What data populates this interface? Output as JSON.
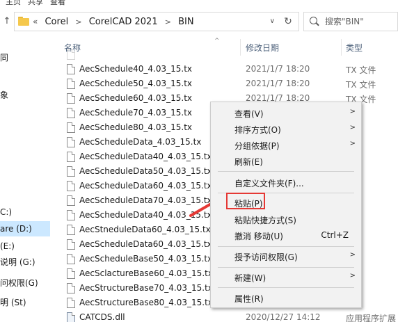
{
  "top_menu": [
    "主页",
    "共享",
    "查看"
  ],
  "address": {
    "prefix": "«",
    "crumbs": [
      "Corel",
      "CorelCAD 2021",
      "BIN"
    ],
    "search_placeholder": "搜索\"BIN\""
  },
  "nav": {
    "items": [
      {
        "label": "同",
        "selected": false
      },
      {
        "label": "象",
        "selected": false
      },
      {
        "label": "C:)",
        "selected": false
      },
      {
        "label": "are (D:)",
        "selected": true
      },
      {
        "label": "(E:)",
        "selected": false
      },
      {
        "label": "说明 (G:)",
        "selected": false
      },
      {
        "label": "问权限(G)",
        "selected": false
      },
      {
        "label": "明 (St)",
        "selected": false
      }
    ]
  },
  "columns": {
    "name": "名称",
    "date": "修改日期",
    "type": "类型"
  },
  "files": [
    {
      "name": "AecSchedule40_4.03_15.tx",
      "date": "2021/1/7 18:20",
      "type": "TX 文件"
    },
    {
      "name": "AecSchedule50_4.03_15.tx",
      "date": "2021/1/7 18:20",
      "type": "TX 文件"
    },
    {
      "name": "AecSchedule60_4.03_15.tx",
      "date": "2021/1/7 18:20",
      "type": "TX 文件"
    },
    {
      "name": "AecSchedule70_4.03_15.tx",
      "date": "",
      "type": ""
    },
    {
      "name": "AecSchedule80_4.03_15.tx",
      "date": "",
      "type": ""
    },
    {
      "name": "AecScheduleData_4.03_15.tx",
      "date": "",
      "type": ""
    },
    {
      "name": "AecScheduleData40_4.03_15.tx",
      "date": "",
      "type": ""
    },
    {
      "name": "AecScheduleData50_4.03_15.tx",
      "date": "",
      "type": ""
    },
    {
      "name": "AecScheduleData60_4.03_15.tx",
      "date": "",
      "type": ""
    },
    {
      "name": "AecScheduleData70_4.03_15.tx",
      "date": "",
      "type": ""
    },
    {
      "name": "AecScheduleData40_4.03_15.tx",
      "date": "",
      "type": ""
    },
    {
      "name": "AecStneduleData60_4.03_15.tx",
      "date": "",
      "type": ""
    },
    {
      "name": "AecScheduleData60_4.03_15.tx",
      "date": "",
      "type": ""
    },
    {
      "name": "AecScheduleBase50_4.03_15.tx",
      "date": "",
      "type": ""
    },
    {
      "name": "AecSclactureBase60_4.03_15.tx",
      "date": "",
      "type": ""
    },
    {
      "name": "AecStructureBase70_4.03_15.tx",
      "date": "",
      "type": ""
    },
    {
      "name": "AecStructureBase80_4.03_15.tx",
      "date": "",
      "type": ""
    },
    {
      "name": "CATCDS.dll",
      "date": "2020/12/27 14:12",
      "type": "应用程序扩展"
    }
  ],
  "context_menu": {
    "items": [
      {
        "label": "查看(V)",
        "submenu": true,
        "shortcut": ""
      },
      {
        "label": "排序方式(O)",
        "submenu": true,
        "shortcut": ""
      },
      {
        "label": "分组依据(P)",
        "submenu": true,
        "shortcut": ""
      },
      {
        "label": "刷新(E)",
        "submenu": false,
        "shortcut": ""
      },
      {
        "label": "自定义文件夹(F)...",
        "submenu": false,
        "shortcut": ""
      },
      {
        "label": "粘贴(P)",
        "submenu": false,
        "shortcut": "",
        "highlighted": true
      },
      {
        "label": "粘贴快捷方式(S)",
        "submenu": false,
        "shortcut": ""
      },
      {
        "label": "撤消 移动(U)",
        "submenu": false,
        "shortcut": "Ctrl+Z"
      },
      {
        "label": "授予访问权限(G)",
        "submenu": true,
        "shortcut": ""
      },
      {
        "label": "新建(W)",
        "submenu": true,
        "shortcut": ""
      },
      {
        "label": "属性(R)",
        "submenu": false,
        "shortcut": ""
      }
    ]
  },
  "colors": {
    "highlight_box": "#e53935",
    "arrow": "#e53935",
    "nav_selected": "#cce8ff",
    "folder": "#f5c84c"
  }
}
